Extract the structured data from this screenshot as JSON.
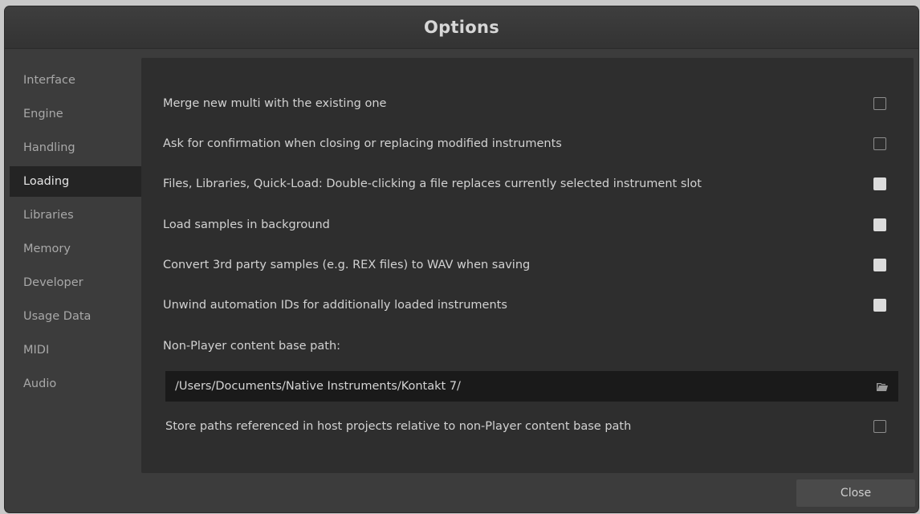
{
  "window": {
    "title": "Options"
  },
  "sidebar": {
    "items": [
      {
        "label": "Interface",
        "active": false
      },
      {
        "label": "Engine",
        "active": false
      },
      {
        "label": "Handling",
        "active": false
      },
      {
        "label": "Loading",
        "active": true
      },
      {
        "label": "Libraries",
        "active": false
      },
      {
        "label": "Memory",
        "active": false
      },
      {
        "label": "Developer",
        "active": false
      },
      {
        "label": "Usage Data",
        "active": false
      },
      {
        "label": "MIDI",
        "active": false
      },
      {
        "label": "Audio",
        "active": false
      }
    ]
  },
  "loading": {
    "options": [
      {
        "label": "Merge new multi with the existing one",
        "checked": false
      },
      {
        "label": "Ask for confirmation when closing or replacing modified instruments",
        "checked": false
      },
      {
        "label": "Files, Libraries, Quick-Load: Double-clicking a file replaces currently selected instrument slot",
        "checked": true
      },
      {
        "label": "Load samples in background",
        "checked": true
      },
      {
        "label": "Convert 3rd party samples (e.g. REX files) to WAV when saving",
        "checked": true
      },
      {
        "label": "Unwind automation IDs for additionally loaded instruments",
        "checked": true
      }
    ],
    "base_path_label": "Non-Player content base path:",
    "base_path_value": "/Users/Documents/Native Instruments/Kontakt 7/",
    "relative_paths": {
      "label": "Store paths referenced in host projects relative to non-Player content base path",
      "checked": false
    }
  },
  "footer": {
    "close_label": "Close"
  },
  "icons": {
    "folder": "folder-open-icon"
  },
  "colors": {
    "window_bg": "#3c3c3c",
    "content_bg": "#2e2e2e",
    "selected_sidebar_bg": "#242424",
    "checkbox_checked": "#dcdcdc"
  }
}
